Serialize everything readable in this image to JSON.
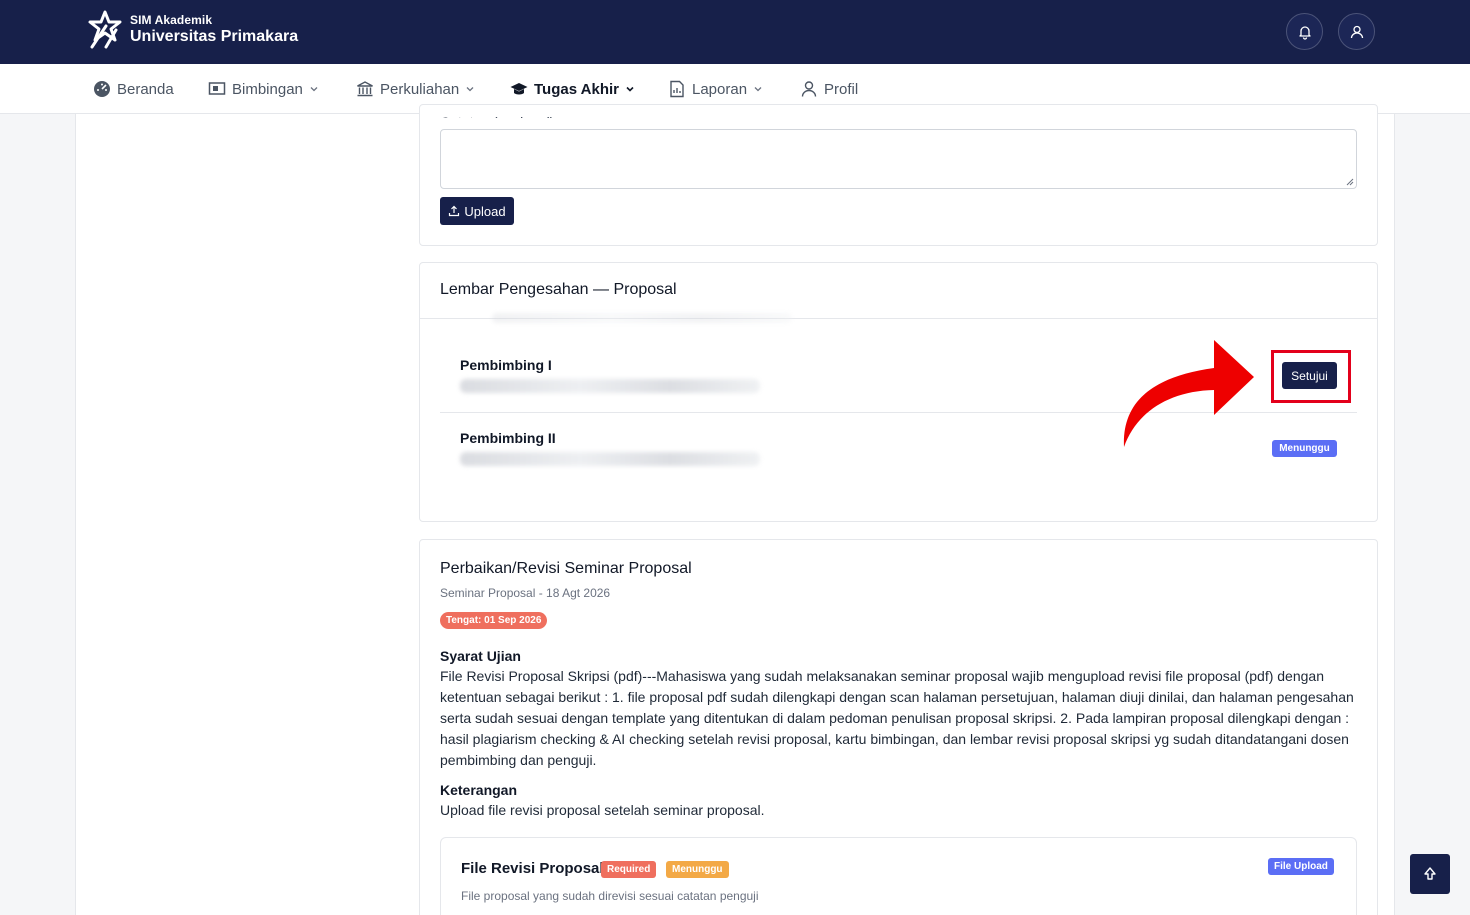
{
  "header": {
    "subtitle": "SIM Akademik",
    "title": "Universitas Primakara"
  },
  "nav": {
    "items": [
      {
        "label": "Beranda",
        "icon": "dashboard-icon"
      },
      {
        "label": "Bimbingan",
        "icon": "presentation-icon"
      },
      {
        "label": "Perkuliahan",
        "icon": "building-icon"
      },
      {
        "label": "Tugas Akhir",
        "icon": "graduation-cap-icon"
      },
      {
        "label": "Laporan",
        "icon": "report-icon"
      },
      {
        "label": "Profil",
        "icon": "user-icon"
      }
    ],
    "active": "Tugas Akhir"
  },
  "upload_form": {
    "notes_label": "Catatan (opsional)",
    "upload_label": "Upload"
  },
  "approval": {
    "title": "Lembar Pengesahan — Proposal",
    "advisors": [
      {
        "role": "Pembimbing I",
        "action_label": "Setujui"
      },
      {
        "role": "Pembimbing II",
        "status_label": "Menunggu"
      }
    ]
  },
  "revision": {
    "title": "Perbaikan/Revisi Seminar Proposal",
    "subtitle": "Seminar Proposal - 18 Agt 2026",
    "deadline_badge": "Tengat: 01 Sep 2026",
    "requirements_heading": "Syarat Ujian",
    "requirements_text": "File Revisi Proposal Skripsi (pdf)---Mahasiswa yang sudah melaksanakan seminar proposal wajib mengupload revisi file proposal (pdf) dengan ketentuan sebagai berikut : 1. file proposal pdf sudah dilengkapi dengan scan halaman persetujuan, halaman diuji dinilai, dan halaman pengesahan serta sudah sesuai dengan template yang ditentukan di dalam pedoman penulisan proposal skripsi. 2. Pada lampiran proposal dilengkapi dengan : hasil plagiarism checking & AI checking setelah revisi proposal, kartu bimbingan, dan lembar revisi proposal skripsi yg sudah ditandatangani dosen pembimbing dan penguji.",
    "notes_heading": "Keterangan",
    "notes_text": "Upload file revisi proposal setelah seminar proposal.",
    "file_item": {
      "title": "File Revisi Proposal",
      "required_badge": "Required",
      "status_badge": "Menunggu",
      "type_badge": "File Upload",
      "description": "File proposal yang sudah direvisi sesuai catatan penguji"
    }
  },
  "colors": {
    "primary": "#17204a",
    "highlight": "#e3001b",
    "badge_blue": "#5b6ef5",
    "badge_red": "#ef6f5e",
    "badge_orange": "#f3a946"
  }
}
